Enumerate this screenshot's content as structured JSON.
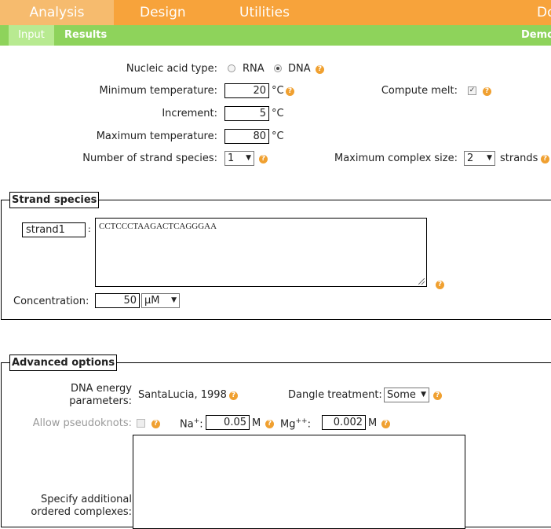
{
  "nav": {
    "tabs": [
      "Analysis",
      "Design",
      "Utilities",
      "Do"
    ],
    "subtabs": [
      "Input",
      "Results"
    ],
    "right_link": "Demo"
  },
  "form": {
    "nucleic_label": "Nucleic acid type:",
    "rna": "RNA",
    "dna": "DNA",
    "min_temp_label": "Minimum temperature:",
    "min_temp": "20",
    "increment_label": "Increment:",
    "increment": "5",
    "max_temp_label": "Maximum temperature:",
    "max_temp": "80",
    "unit_c": "°C",
    "compute_melt_label": "Compute melt:",
    "strand_species_label": "Number of strand species:",
    "strand_species": "1",
    "max_complex_label": "Maximum complex size:",
    "max_complex": "2",
    "strands_unit": "strands"
  },
  "strands": {
    "legend": "Strand species",
    "name": "strand1",
    "sep": ":",
    "sequence": "CCTCCCTAAGACTCAGGGAA",
    "conc_label": "Concentration:",
    "conc_value": "50",
    "conc_unit": "µM"
  },
  "advanced": {
    "legend": "Advanced options",
    "dna_energy_label_1": "DNA energy",
    "dna_energy_label_2": "parameters:",
    "dna_energy_value": "SantaLucia, 1998",
    "dangle_label": "Dangle treatment:",
    "dangle_value": "Some",
    "pseudoknots_label": "Allow pseudoknots:",
    "na_label": "Na",
    "na_sup": "+",
    "na_value": "0.05",
    "mg_label": "Mg",
    "mg_sup": "++",
    "mg_value": "0.002",
    "molar": "M",
    "colon": ":",
    "ordered_label_1": "Specify additional",
    "ordered_label_2": "ordered complexes:"
  },
  "colors": {
    "nav_orange": "#f7a33b",
    "nav_green": "#8ed35b",
    "help": "#f0a030"
  }
}
